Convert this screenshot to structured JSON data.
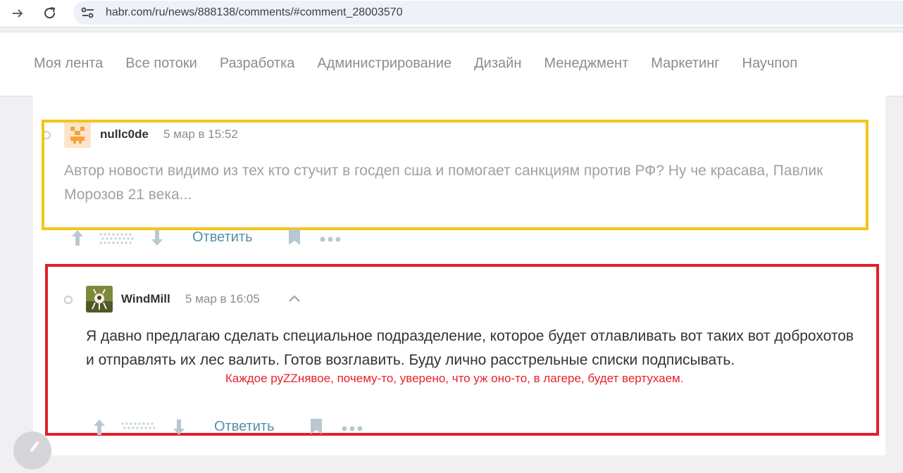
{
  "browser": {
    "url": "habr.com/ru/news/888138/comments/#comment_28003570",
    "forward_icon": "arrow-right-icon",
    "reload_icon": "reload-icon",
    "site_info_icon": "tune-icon"
  },
  "nav": {
    "items": [
      "Моя лента",
      "Все потоки",
      "Разработка",
      "Администрирование",
      "Дизайн",
      "Менеджмент",
      "Маркетинг",
      "Научпоп"
    ]
  },
  "comments": [
    {
      "author": "nullc0de",
      "time": "5 мар в 15:52",
      "text": "Автор новости видимо из тех кто стучит в госдеп сша и помогает санкциям против РФ? Ну че красава, Павлик Морозов 21 века...",
      "reply_label": "Ответить"
    },
    {
      "author": "WindMill",
      "time": "5 мар в 16:05",
      "text": "Я давно предлагаю сделать специальное подразделение, которое будет отлавливать вот таких вот доброхотов и отправлять их лес валить. Готов возглавить. Буду лично расстрельные списки подписывать.",
      "reply_label": "Ответить"
    }
  ],
  "annotation": {
    "note": "Каждое руZZнявое, почему-то, уверено, что уж оно-то, в лагере, будет вертухаем."
  },
  "colors": {
    "highlight_yellow": "#f5c518",
    "highlight_red": "#e0202a",
    "link": "#548eaa"
  }
}
